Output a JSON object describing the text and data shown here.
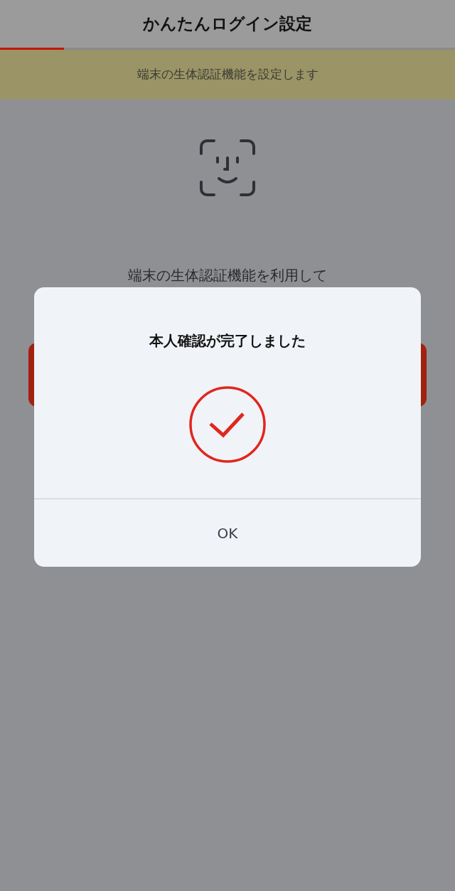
{
  "header": {
    "title": "かんたんログイン設定"
  },
  "progress": {
    "level": 0.14
  },
  "banner": {
    "text": "端末の生体認証機能を設定します"
  },
  "description": "端末の生体認証機能を利用して",
  "dialog": {
    "title": "本人確認が完了しました",
    "button": "OK"
  }
}
